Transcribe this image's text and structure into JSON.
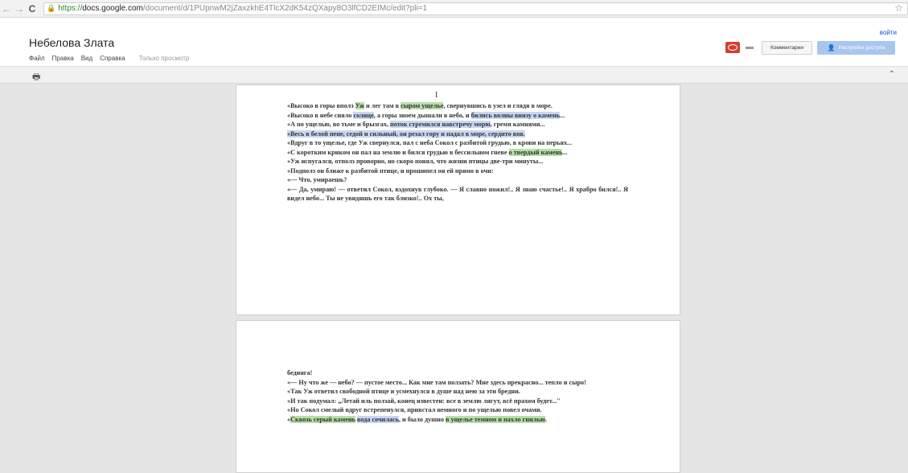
{
  "browser": {
    "url_scheme": "https://",
    "url_host": "docs.google.com",
    "url_path": "/document/d/1PUpnwM2jZaxzkhE4TlcX2dK54zQXapy8O3lfCD2EIMc/edit?pli=1"
  },
  "header": {
    "title": "Небелова Злата",
    "menu": [
      "Файл",
      "Правка",
      "Вид",
      "Справка"
    ],
    "view_only": "Только просмотр",
    "signin": "войти",
    "comments_label": "Комментарии",
    "share_label": "Настройки доступа"
  },
  "document": {
    "cursor": "I",
    "page1": [
      [
        {
          "t": "«Высоко в горы вполз "
        },
        {
          "t": "Уж",
          "h": "green"
        },
        {
          "t": " и лег там в "
        },
        {
          "t": "сыром ущелье",
          "h": "green"
        },
        {
          "t": ", свернувшись в узел и глядя в море."
        }
      ],
      [
        {
          "t": "«Высоко в небе сияло "
        },
        {
          "t": "солнце",
          "h": "blue"
        },
        {
          "t": ", а горы зноем дышали в небо, и "
        },
        {
          "t": "бились волны внизу о камень",
          "h": "blue"
        },
        {
          "t": "..."
        }
      ],
      [
        {
          "t": "«А по ущелью, во тьме и брызгах, "
        },
        {
          "t": "поток стремился навстречу морю",
          "h": "blue"
        },
        {
          "t": ", гремя камнями..."
        }
      ],
      [
        {
          "t": "«Весь в белой пене, седой и сильный, он резал гору и падал в море, сердито воя.",
          "h": "blue"
        }
      ],
      [
        {
          "t": "«Вдруг в то ущелье, где Уж свернулся, пал с неба Сокол с разбитой грудью, в крови на перьях..."
        }
      ],
      [
        {
          "t": "«С коротким криком он пал на землю и бился грудью в бессильном гневе "
        },
        {
          "t": "о твердый камень",
          "h": "green"
        },
        {
          "t": "..."
        }
      ],
      [
        {
          "t": "«Уж испугался, отполз проворно, но скоро понял, что жизни птицы две-три минуты..."
        }
      ],
      [
        {
          "t": "«Подполз он ближе к разбитой птице, и прошипел он ей прямо в очи:"
        }
      ],
      [
        {
          "t": "«— Что, умираешь?"
        }
      ],
      [
        {
          "t": "«— Да, умираю! — ответил Сокол, вздохнув глубоко. — Я славно пожил!.. Я знаю счастье!.. Я храбро бился!.. Я видел небо... Ты не увидишь его так близко!.. Ох ты,"
        }
      ]
    ],
    "page2": [
      [
        {
          "t": "бедняга!"
        }
      ],
      [
        {
          "t": "«— Ну что же — небо? — пустое место... Как мне там ползать? Мне здесь прекрасно... тепло и сыро!"
        }
      ],
      [
        {
          "t": "«Так Уж ответил свободной птице и усмехнулся в душе над нею за эти бредни."
        }
      ],
      [
        {
          "t": "«И так подумал: „Летай иль ползай, конец известен: все в землю лягут, всё прахом будет...\""
        }
      ],
      [
        {
          "t": "«Но Сокол смелый вдруг встрепенулся, привстал немного и по ущелью повел очами."
        }
      ],
      [
        {
          "t": "«"
        },
        {
          "t": "Сквозь серый камень",
          "h": "green"
        },
        {
          "t": " "
        },
        {
          "t": "вода сочилась",
          "h": "blue"
        },
        {
          "t": ", и было душно "
        },
        {
          "t": "в ущелье темном и пахло гнилью",
          "h": "green"
        },
        {
          "t": "."
        }
      ]
    ]
  }
}
